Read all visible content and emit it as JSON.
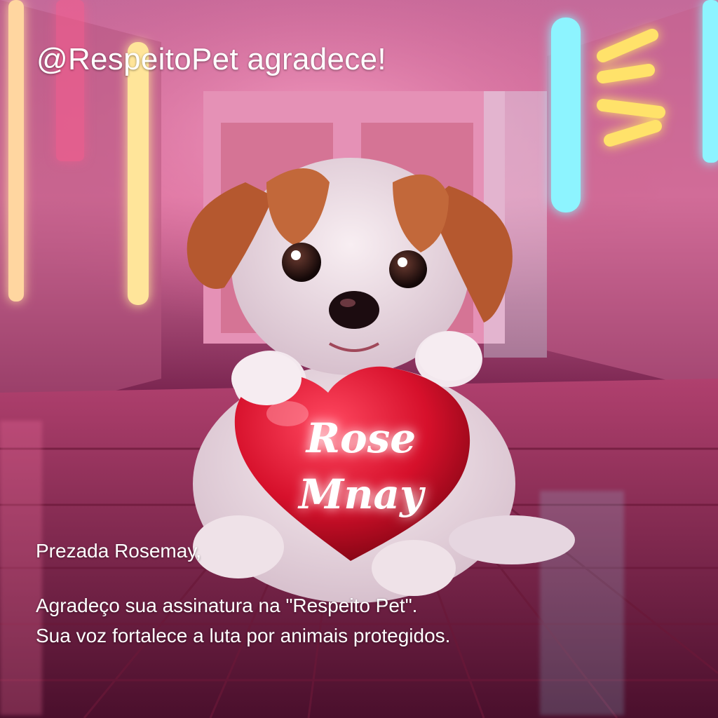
{
  "header": {
    "headline": "@RespeitoPet agradece!"
  },
  "message": {
    "greeting": "Prezada Rosemay,",
    "line1": "Agradeço sua assinatura na \"Respeito Pet\".",
    "line2": "Sua voz fortalece a luta por animais protegidos."
  },
  "heart": {
    "name_line1": "Rose",
    "name_line2": "Mnay"
  },
  "colors": {
    "neon_pink": "#ff4f8a",
    "neon_cyan": "#7ef4ff",
    "neon_yellow": "#ffe26a",
    "heart_red": "#e0142e"
  }
}
